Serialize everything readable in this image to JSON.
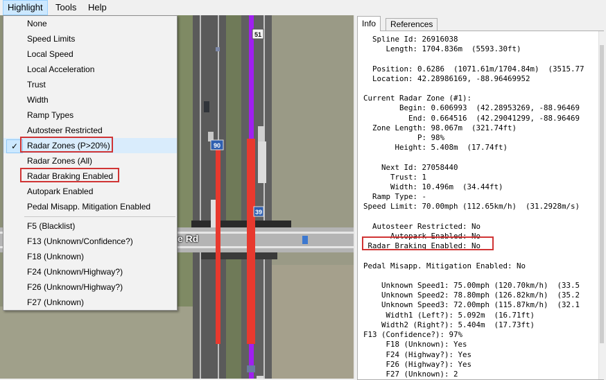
{
  "menubar": {
    "highlight": "Highlight",
    "tools": "Tools",
    "help": "Help"
  },
  "dropdown": {
    "items": [
      {
        "label": "None"
      },
      {
        "label": "Speed Limits"
      },
      {
        "label": "Local Speed"
      },
      {
        "label": "Local Acceleration"
      },
      {
        "label": "Trust"
      },
      {
        "label": "Width"
      },
      {
        "label": "Ramp Types"
      },
      {
        "label": "Autosteer Restricted"
      },
      {
        "label": "Radar Zones (P>20%)",
        "checked": true
      },
      {
        "label": "Radar Zones (All)"
      },
      {
        "label": "Radar Braking Enabled"
      },
      {
        "label": "Autopark Enabled"
      },
      {
        "label": "Pedal Misapp. Mitigation Enabled"
      },
      {
        "label": "F5 (Blacklist)"
      },
      {
        "label": "F13 (Unknown/Confidence?)"
      },
      {
        "label": "F18 (Unknown)"
      },
      {
        "label": "F24 (Unknown/Highway?)"
      },
      {
        "label": "F26 (Unknown/Highway?)"
      },
      {
        "label": "F27 (Unknown)"
      }
    ],
    "check_mark": "✓"
  },
  "map": {
    "shield_top": "51",
    "shield_mid": "90",
    "shield_low": "39",
    "road_name_fragment": "e Rd"
  },
  "tabs": {
    "info": "Info",
    "references": "References"
  },
  "info_lines": [
    "  Spline Id: 26916038",
    "     Length: 1704.836m  (5593.30ft)",
    "",
    "  Position: 0.6286  (1071.61m/1704.84m)  (3515.77",
    "  Location: 42.28986169, -88.96469952",
    "",
    "Current Radar Zone (#1):",
    "        Begin: 0.606993  (42.28953269, -88.96469",
    "          End: 0.664516  (42.29041299, -88.96469",
    "  Zone Length: 98.067m  (321.74ft)",
    "            P: 98%",
    "       Height: 5.408m  (17.74ft)",
    "",
    "    Next Id: 27058440",
    "      Trust: 1",
    "      Width: 10.496m  (34.44ft)",
    "  Ramp Type: -",
    "Speed Limit: 70.00mph (112.65km/h)  (31.2928m/s)",
    "",
    "  Autosteer Restricted: No",
    "      Autopark Enabled: No",
    " Radar Braking Enabled: No",
    "",
    "Pedal Misapp. Mitigation Enabled: No",
    "",
    "    Unknown Speed1: 75.00mph (120.70km/h)  (33.5",
    "    Unknown Speed2: 78.80mph (126.82km/h)  (35.2",
    "    Unknown Speed3: 72.00mph (115.87km/h)  (32.1",
    "     Width1 (Left?): 5.092m  (16.71ft)",
    "    Width2 (Right?): 5.404m  (17.73ft)",
    "F13 (Confidence?): 97%",
    "     F18 (Unknown): Yes",
    "     F24 (Highway?): Yes",
    "     F26 (Highway?): Yes",
    "     F27 (Unknown): 2"
  ],
  "colors": {
    "highlight_red": "#e8392e",
    "purple_route": "#a020f0",
    "annotation_red": "#d03434"
  }
}
